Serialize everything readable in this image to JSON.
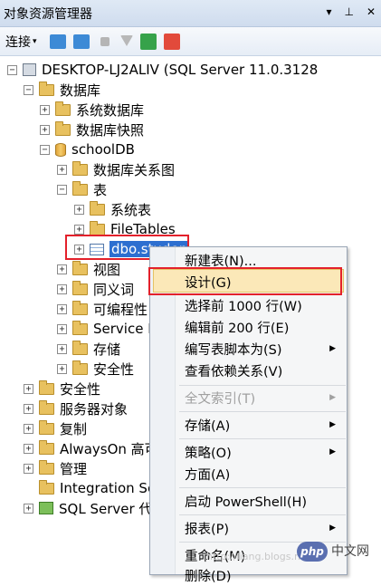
{
  "panel": {
    "title": "对象资源管理器",
    "pin": "▾ ꟸ ✕"
  },
  "toolbar": {
    "connect_label": "连接"
  },
  "tree": {
    "server": "DESKTOP-LJ2ALIV (SQL Server 11.0.3128",
    "databases": "数据库",
    "system_databases": "系统数据库",
    "snapshots": "数据库快照",
    "schooldb": "schoolDB",
    "diagrams": "数据库关系图",
    "tables": "表",
    "system_tables": "系统表",
    "filetables": "FileTables",
    "student_table": "dbo.studen",
    "views": "视图",
    "synonyms": "同义词",
    "programmability": "可编程性",
    "service_broker": "Service B",
    "storage": "存储",
    "security_db": "安全性",
    "security": "安全性",
    "server_objects": "服务器对象",
    "replication": "复制",
    "alwayson": "AlwaysOn 高可",
    "management": "管理",
    "integration": "Integration Se",
    "agent": "SQL Server 代理"
  },
  "context_menu": {
    "new_table": "新建表(N)...",
    "design": "设计(G)",
    "select_top": "选择前 1000 行(W)",
    "edit_top": "编辑前 200 行(E)",
    "script_table": "编写表脚本为(S)",
    "view_deps": "查看依赖关系(V)",
    "fulltext": "全文索引(T)",
    "storage": "存储(A)",
    "policies": "策略(O)",
    "facets": "方面(A)",
    "powershell": "启动 PowerShell(H)",
    "reports": "报表(P)",
    "rename": "重命名(M)",
    "delete": "删除(D)"
  },
  "watermark": {
    "url": "http://liang.blogs.net",
    "badge": "php",
    "site": "中文网"
  }
}
